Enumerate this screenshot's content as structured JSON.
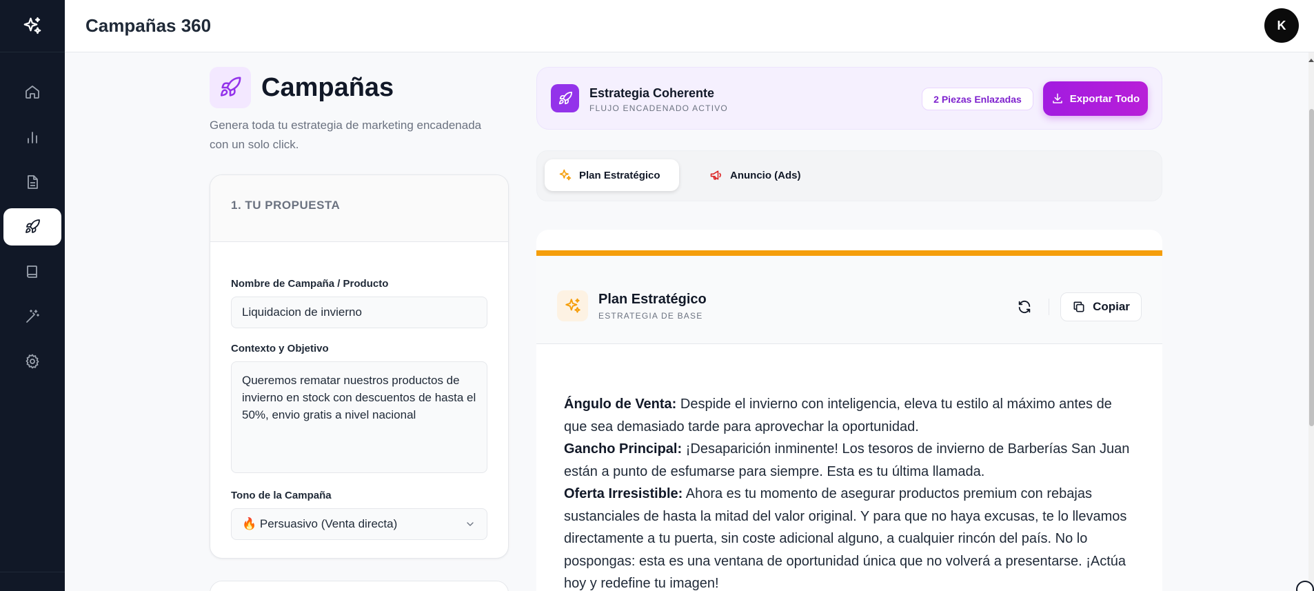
{
  "app": {
    "title": "Campañas 360",
    "avatar_initial": "K"
  },
  "sidebar": {
    "items": [
      {
        "name": "home",
        "icon": "home-icon"
      },
      {
        "name": "analytics",
        "icon": "bar-chart-icon"
      },
      {
        "name": "documents",
        "icon": "document-icon"
      },
      {
        "name": "campaigns",
        "icon": "rocket-icon",
        "active": true
      },
      {
        "name": "library",
        "icon": "book-icon"
      },
      {
        "name": "magic",
        "icon": "magic-wand-icon"
      },
      {
        "name": "settings",
        "icon": "gear-icon"
      }
    ]
  },
  "page": {
    "title": "Campañas",
    "subtitle": "Genera toda tu estrategia de marketing encadenada con un solo click."
  },
  "form": {
    "section_title": "1. TU PROPUESTA",
    "name_label": "Nombre de Campaña / Producto",
    "name_value": "Liquidacion de invierno",
    "context_label": "Contexto y Objetivo",
    "context_value": "Queremos rematar nuestros productos de invierno en stock con descuentos de hasta el 50%, envio gratis a nivel nacional",
    "tone_label": "Tono de la Campaña",
    "tone_value": "🔥 Persuasivo (Venta directa)"
  },
  "strategy": {
    "title": "Estrategia Coherente",
    "subtitle": "FLUJO ENCADENADO ACTIVO",
    "badge": "2 Piezas Enlazadas",
    "export_label": "Exportar Todo"
  },
  "tabs": [
    {
      "label": "Plan Estratégico",
      "icon": "sparkles-icon",
      "active": true
    },
    {
      "label": "Anuncio (Ads)",
      "icon": "megaphone-icon",
      "active": false
    }
  ],
  "content": {
    "title": "Plan Estratégico",
    "subtitle": "ESTRATEGIA DE BASE",
    "copy_label": "Copiar",
    "sections": [
      {
        "label": "Ángulo de Venta:",
        "text": " Despide el invierno con inteligencia, eleva tu estilo al máximo antes de que sea demasiado tarde para aprovechar la oportunidad."
      },
      {
        "label": "Gancho Principal:",
        "text": " ¡Desaparición inminente! Los tesoros de invierno de Barberías San Juan están a punto de esfumarse para siempre. Esta es tu última llamada."
      },
      {
        "label": "Oferta Irresistible:",
        "text": " Ahora es tu momento de asegurar productos premium con rebajas sustanciales de hasta la mitad del valor original. Y para que no haya excusas, te lo llevamos directamente a tu puerta, sin coste adicional alguno, a cualquier rincón del país. No lo pospongas: esta es una ventana de oportunidad única que no volverá a presentarse. ¡Actúa hoy y redefine tu imagen!"
      }
    ]
  },
  "colors": {
    "sidebar_bg": "#111827",
    "accent_purple": "#9333ea",
    "accent_orange": "#f59e0b"
  }
}
